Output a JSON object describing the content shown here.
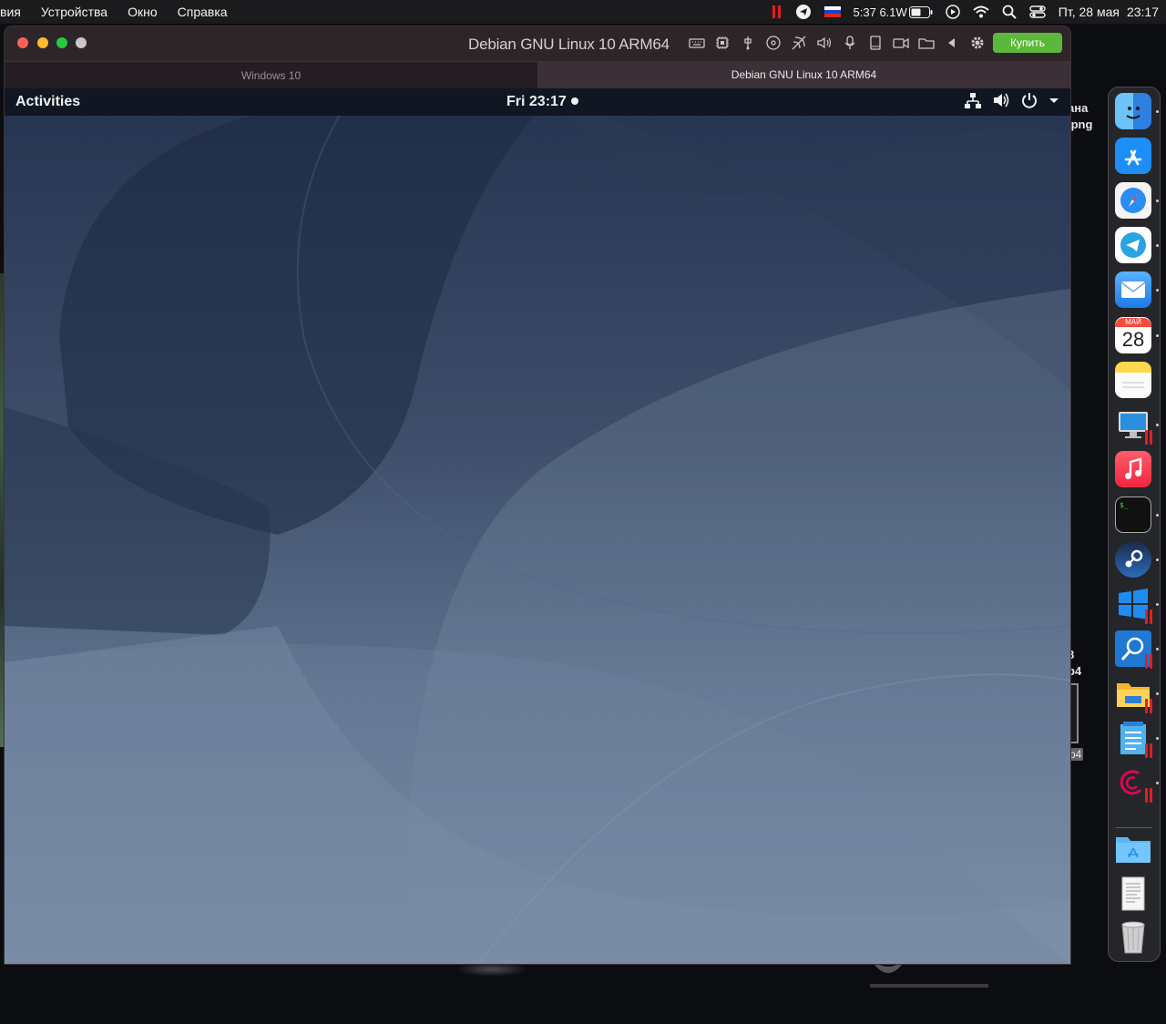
{
  "mac_menubar": {
    "app_name_partial": "вия",
    "menus": [
      "Устройства",
      "Окно",
      "Справка"
    ],
    "battery_status": "5:37 6.1W",
    "datetime": "Пт, 28 мая",
    "time": "23:17",
    "icons": [
      "parallels-pause-icon",
      "telegram-menu-icon",
      "flag-ru-icon",
      "battery-icon",
      "play-icon",
      "wifi-icon",
      "spotlight-search-icon",
      "control-center-icon"
    ]
  },
  "desktop": {
    "file_label_1": "ана",
    "file_label_2": ".png",
    "file_label_3": "8",
    "file_label_4": "p4",
    "file_label_5": "p4"
  },
  "vm_window": {
    "title": "Debian GNU Linux 10 ARM64",
    "buy_label": "Купить",
    "tabs": [
      {
        "label": "Windows 10",
        "active": false
      },
      {
        "label": "Debian GNU Linux 10 ARM64",
        "active": true
      }
    ],
    "toolbar_icons": [
      "keyboard-icon",
      "cpu-icon",
      "usb-icon",
      "cd-icon",
      "network-icon",
      "sound-icon",
      "microphone-icon",
      "tablet-icon",
      "camera-icon",
      "shared-folder-icon",
      "back-arrow-icon",
      "gear-icon"
    ]
  },
  "guest": {
    "activities_label": "Activities",
    "clock": "Fri 23:17",
    "tray_icons": [
      "network-wired-icon",
      "volume-icon",
      "power-icon",
      "dropdown-arrow-icon"
    ]
  },
  "dock": {
    "items": [
      {
        "name": "finder",
        "running": true
      },
      {
        "name": "app-store",
        "running": false
      },
      {
        "name": "safari",
        "running": true
      },
      {
        "name": "telegram",
        "running": true
      },
      {
        "name": "mail",
        "running": true
      },
      {
        "name": "calendar",
        "running": true,
        "month": "МАЙ",
        "day": "28"
      },
      {
        "name": "notes",
        "running": false
      },
      {
        "name": "parallels-vm",
        "running": true
      },
      {
        "name": "music",
        "running": false
      },
      {
        "name": "terminal",
        "running": true,
        "glyph": "$_"
      },
      {
        "name": "steam",
        "running": true
      },
      {
        "name": "windows",
        "running": true
      },
      {
        "name": "search-app",
        "running": true
      },
      {
        "name": "file-explorer",
        "running": true
      },
      {
        "name": "notepad",
        "running": true
      },
      {
        "name": "debian",
        "running": true
      },
      {
        "name": "applications-folder",
        "running": false
      },
      {
        "name": "document",
        "running": false
      },
      {
        "name": "trash",
        "running": false
      }
    ],
    "colors": {
      "finder": "#2d9cf0",
      "app_store": "#1c8ef6",
      "telegram": "#2aa3e0",
      "mail": "#2f8cf0",
      "music": "#fa3d52",
      "steam": "#1b2b4a",
      "windows": "#1e8cf2",
      "debian_red": "#d70a53",
      "parallels_red": "#e02020"
    }
  }
}
